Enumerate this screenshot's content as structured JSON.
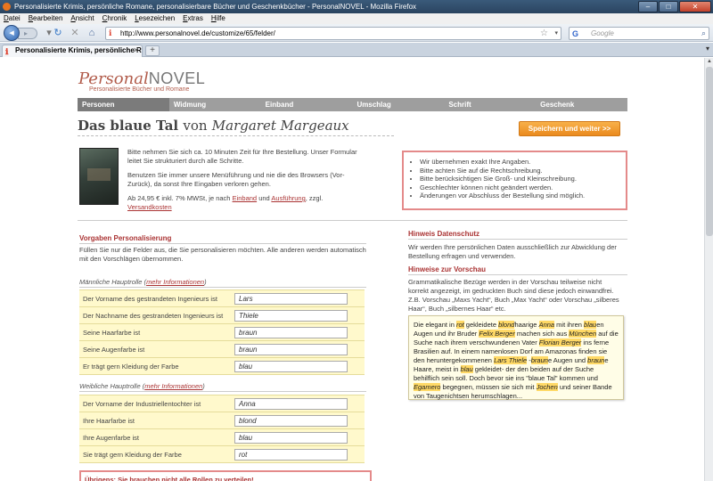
{
  "window": {
    "title": "Personalisierte Krimis, persönliche Romane, personalisierbare Bücher und Geschenkbücher - PersonalNOVEL - Mozilla Firefox"
  },
  "menu": [
    "Datei",
    "Bearbeiten",
    "Ansicht",
    "Chronik",
    "Lesezeichen",
    "Extras",
    "Hilfe"
  ],
  "address": {
    "url": "http://www.personalnovel.de/customize/65/felder/",
    "search_placeholder": "Google"
  },
  "tab": {
    "label": "Personalisierte Krimis, persönliche R...",
    "new_tab": "+"
  },
  "site": {
    "logo_part1": "Personal",
    "logo_part2": "NOVEL",
    "tagline": "Personalisierte Bücher und Romane",
    "steps": [
      "Personen",
      "Widmung",
      "Einband",
      "Umschlag",
      "Schrift",
      "Geschenk"
    ],
    "active_step": 0
  },
  "book": {
    "title": "Das blaue Tal",
    "von": "von",
    "author": "Margaret Margeaux",
    "save_button": "Speichern und weiter >>",
    "intro1": "Bitte nehmen Sie sich ca. 10 Minuten Zeit für Ihre Bestellung. Unser Formular leitet Sie strukturiert durch alle Schritte.",
    "intro2": "Benutzen Sie immer unsere Menüführung und nie die des Browsers (Vor-Zurück), da sonst Ihre Eingaben verloren gehen.",
    "price_prefix": "Ab 24,95 € inkl. 7% MWSt, je nach",
    "price_link1": "Einband",
    "price_and": "und",
    "price_link2": "Ausführung",
    "price_suffix": ", zzgl.",
    "price_link3": "Versandkosten"
  },
  "notes": [
    "Wir übernehmen exakt Ihre Angaben.",
    "Bitte achten Sie auf die Rechtschreibung.",
    "Bitte berücksichtigen Sie Groß- und Kleinschreibung.",
    "Geschlechter können nicht geändert werden.",
    "Änderungen vor Abschluss der Bestellung sind möglich."
  ],
  "form": {
    "heading": "Vorgaben Personalisierung",
    "note": "Füllen Sie nur die Felder aus, die Sie personalisieren möchten. Alle anderen werden automatisch mit den Vorschlägen übernommen.",
    "more_info": "mehr Informationen",
    "male_heading": "Männliche Hauptrolle",
    "male_fields": [
      {
        "label": "Der Vorname des gestrandeten Ingenieurs ist",
        "value": "Lars"
      },
      {
        "label": "Der Nachname des gestrandeten Ingenieurs ist",
        "value": "Thiele"
      },
      {
        "label": "Seine Haarfarbe ist",
        "value": "braun"
      },
      {
        "label": "Seine Augenfarbe ist",
        "value": "braun"
      },
      {
        "label": "Er trägt gern Kleidung der Farbe",
        "value": "blau"
      }
    ],
    "female_heading": "Weibliche Hauptrolle",
    "female_fields": [
      {
        "label": "Der Vorname der Industriellentochter ist",
        "value": "Anna"
      },
      {
        "label": "Ihre Haarfarbe ist",
        "value": "blond"
      },
      {
        "label": "Ihre Augenfarbe ist",
        "value": "blau"
      },
      {
        "label": "Sie trägt gern Kleidung der Farbe",
        "value": "rot"
      }
    ],
    "warning": "Übrigens: Sie brauchen nicht alle Rollen zu verteilen!"
  },
  "sidebar": {
    "privacy_heading": "Hinweis Datenschutz",
    "privacy_text": "Wir werden Ihre persönlichen Daten ausschließlich zur Abwicklung der Bestellung erfragen und verwenden.",
    "preview_heading": "Hinweise zur Vorschau",
    "preview_text": "Grammatikalische Bezüge werden in der Vorschau teilweise nicht korrekt angezeigt, im gedruckten Buch sind diese jedoch einwandfrei. Z.B. Vorschau „Maxs Yacht“, Buch „Max Yacht“ oder Vorschau „silberes Haar“, Buch „silbernes Haar“ etc.",
    "preview_segments": [
      {
        "t": "Die elegant in ",
        "h": false
      },
      {
        "t": "rot",
        "h": true
      },
      {
        "t": " gekleidete ",
        "h": false
      },
      {
        "t": "blond",
        "h": true
      },
      {
        "t": "haarige ",
        "h": false
      },
      {
        "t": "Anna",
        "h": true
      },
      {
        "t": " mit ihren ",
        "h": false
      },
      {
        "t": "blau",
        "h": true
      },
      {
        "t": "en Augen und ihr Bruder ",
        "h": false
      },
      {
        "t": "Felix Berger",
        "h": true
      },
      {
        "t": " machen sich aus ",
        "h": false
      },
      {
        "t": "München",
        "h": true
      },
      {
        "t": " auf die Suche nach ihrem verschwundenen Vater ",
        "h": false
      },
      {
        "t": "Florian Berger",
        "h": true
      },
      {
        "t": " ins ferne Brasilien auf. In einem namenlosen Dorf am Amazonas finden sie den heruntergekommenen ",
        "h": false
      },
      {
        "t": "Lars Thiele",
        "h": true
      },
      {
        "t": " -",
        "h": false
      },
      {
        "t": "braun",
        "h": true
      },
      {
        "t": "e Augen und ",
        "h": false
      },
      {
        "t": "braun",
        "h": true
      },
      {
        "t": "e Haare, meist in ",
        "h": false
      },
      {
        "t": "blau",
        "h": true
      },
      {
        "t": " gekleidet- der den beiden auf der Suche behilflich sein soll. Doch bevor sie ins \"blaue Tal\" kommen und ",
        "h": false
      },
      {
        "t": "Egamero",
        "h": true
      },
      {
        "t": " begegnen, müssen sie sich mit ",
        "h": false
      },
      {
        "t": "Jochen",
        "h": true
      },
      {
        "t": " und seiner Bande von Taugenichtsen herumschlagen...",
        "h": false
      }
    ]
  }
}
